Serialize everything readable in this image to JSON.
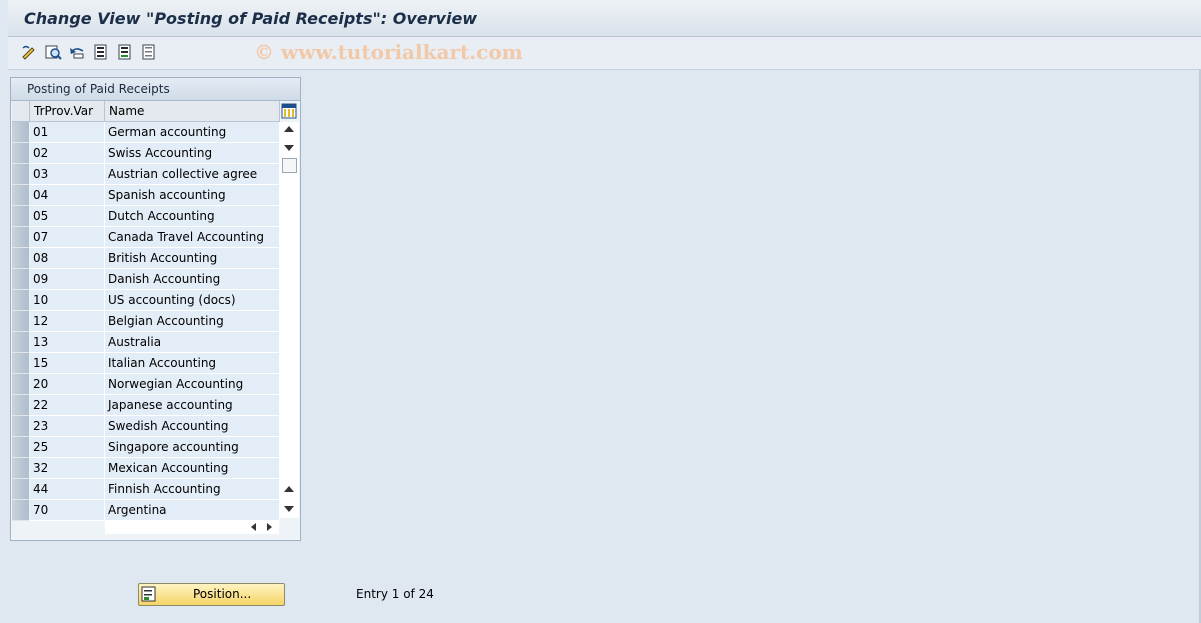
{
  "title": "Change View \"Posting of Paid Receipts\": Overview",
  "toolbar": {
    "icons": [
      "change-display-icon",
      "details-icon",
      "undo-icon",
      "select-all-icon",
      "select-block-icon",
      "deselect-all-icon"
    ]
  },
  "watermark": "© www.tutorialkart.com",
  "table": {
    "title": "Posting of Paid Receipts",
    "columns": [
      "TrProv.Var",
      "Name"
    ],
    "rows": [
      {
        "var": "01",
        "name": "German accounting"
      },
      {
        "var": "02",
        "name": "Swiss Accounting"
      },
      {
        "var": "03",
        "name": "Austrian collective agree"
      },
      {
        "var": "04",
        "name": "Spanish accounting"
      },
      {
        "var": "05",
        "name": "Dutch Accounting"
      },
      {
        "var": "07",
        "name": "Canada Travel Accounting"
      },
      {
        "var": "08",
        "name": "British Accounting"
      },
      {
        "var": "09",
        "name": "Danish Accounting"
      },
      {
        "var": "10",
        "name": "US accounting (docs)"
      },
      {
        "var": "12",
        "name": "Belgian Accounting"
      },
      {
        "var": "13",
        "name": "Australia"
      },
      {
        "var": "15",
        "name": "Italian Accounting"
      },
      {
        "var": "20",
        "name": "Norwegian Accounting"
      },
      {
        "var": "22",
        "name": "Japanese accounting"
      },
      {
        "var": "23",
        "name": "Swedish Accounting"
      },
      {
        "var": "25",
        "name": "Singapore accounting"
      },
      {
        "var": "32",
        "name": "Mexican Accounting"
      },
      {
        "var": "44",
        "name": "Finnish Accounting"
      },
      {
        "var": "70",
        "name": "Argentina"
      }
    ]
  },
  "position_button": "Position...",
  "entry_text": "Entry 1 of 24",
  "colors": {
    "title_text": "#1c2f48",
    "button_fill": "#f5d468",
    "watermark": "#f2c9a8"
  }
}
